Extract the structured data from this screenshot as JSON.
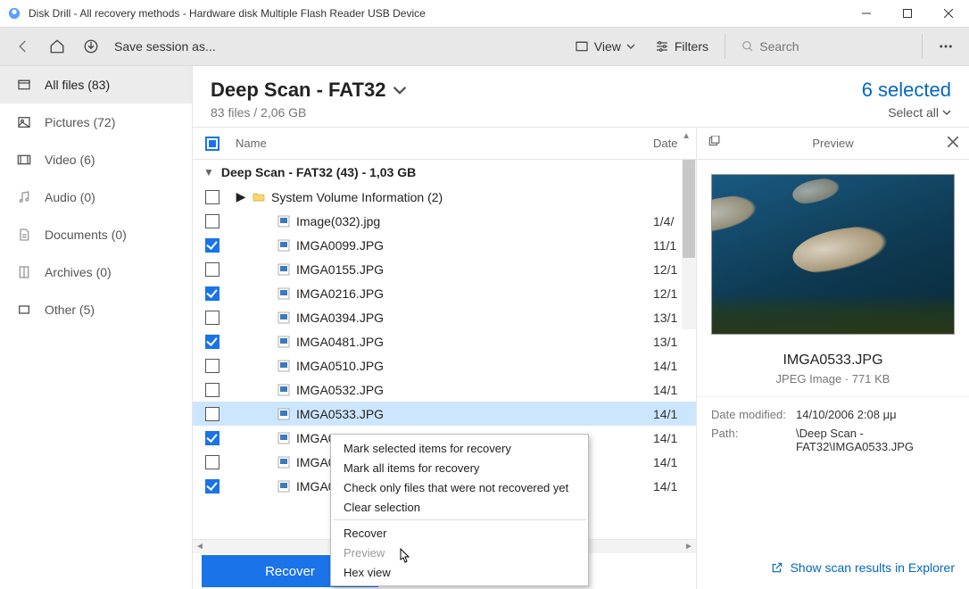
{
  "titlebar": {
    "title": "Disk Drill - All recovery methods - Hardware disk Multiple Flash Reader USB Device"
  },
  "toolbar": {
    "save_label": "Save session as...",
    "view_label": "View",
    "filters_label": "Filters",
    "search_placeholder": "Search"
  },
  "sidebar": {
    "items": [
      {
        "label": "All files (83)"
      },
      {
        "label": "Pictures (72)"
      },
      {
        "label": "Video (6)"
      },
      {
        "label": "Audio (0)"
      },
      {
        "label": "Documents (0)"
      },
      {
        "label": "Archives (0)"
      },
      {
        "label": "Other (5)"
      }
    ]
  },
  "header": {
    "title": "Deep Scan - FAT32",
    "subtitle": "83 files / 2,06 GB",
    "selected": "6 selected",
    "select_all": "Select all"
  },
  "columns": {
    "name": "Name",
    "date": "Date"
  },
  "group": {
    "label": "Deep Scan - FAT32 (43) - 1,03 GB"
  },
  "files": [
    {
      "name": "System Volume Information (2)",
      "date": "",
      "folder": true,
      "checked": false,
      "highlight": false
    },
    {
      "name": "Image(032).jpg",
      "date": "1/4/",
      "folder": false,
      "checked": false,
      "highlight": false
    },
    {
      "name": "IMGA0099.JPG",
      "date": "11/1",
      "folder": false,
      "checked": true,
      "highlight": false
    },
    {
      "name": "IMGA0155.JPG",
      "date": "12/1",
      "folder": false,
      "checked": false,
      "highlight": false
    },
    {
      "name": "IMGA0216.JPG",
      "date": "12/1",
      "folder": false,
      "checked": true,
      "highlight": false
    },
    {
      "name": "IMGA0394.JPG",
      "date": "13/1",
      "folder": false,
      "checked": false,
      "highlight": false
    },
    {
      "name": "IMGA0481.JPG",
      "date": "13/1",
      "folder": false,
      "checked": true,
      "highlight": false
    },
    {
      "name": "IMGA0510.JPG",
      "date": "14/1",
      "folder": false,
      "checked": false,
      "highlight": false
    },
    {
      "name": "IMGA0532.JPG",
      "date": "14/1",
      "folder": false,
      "checked": false,
      "highlight": false
    },
    {
      "name": "IMGA0533.JPG",
      "date": "14/1",
      "folder": false,
      "checked": false,
      "highlight": true
    },
    {
      "name": "IMGA0",
      "date": "14/1",
      "folder": false,
      "checked": true,
      "highlight": false
    },
    {
      "name": "IMGA0",
      "date": "14/1",
      "folder": false,
      "checked": false,
      "highlight": false
    },
    {
      "name": "IMGA0",
      "date": "14/1",
      "folder": false,
      "checked": true,
      "highlight": false
    }
  ],
  "recover_button": "Recover",
  "context_menu": {
    "items": [
      {
        "label": "Mark selected items for recovery",
        "disabled": false,
        "sep": false
      },
      {
        "label": "Mark all items for recovery",
        "disabled": false,
        "sep": false
      },
      {
        "label": "Check only files that were not recovered yet",
        "disabled": false,
        "sep": false
      },
      {
        "label": "Clear selection",
        "disabled": false,
        "sep": true
      },
      {
        "label": "Recover",
        "disabled": false,
        "sep": false
      },
      {
        "label": "Preview",
        "disabled": true,
        "sep": false
      },
      {
        "label": "Hex view",
        "disabled": false,
        "sep": false
      }
    ]
  },
  "preview": {
    "title": "Preview",
    "filename": "IMGA0533.JPG",
    "filetype": "JPEG Image · 771 KB",
    "date_modified_label": "Date modified:",
    "date_modified": "14/10/2006 2:08 μμ",
    "path_label": "Path:",
    "path": "\\Deep Scan - FAT32\\IMGA0533.JPG",
    "footer": "Show scan results in Explorer"
  }
}
